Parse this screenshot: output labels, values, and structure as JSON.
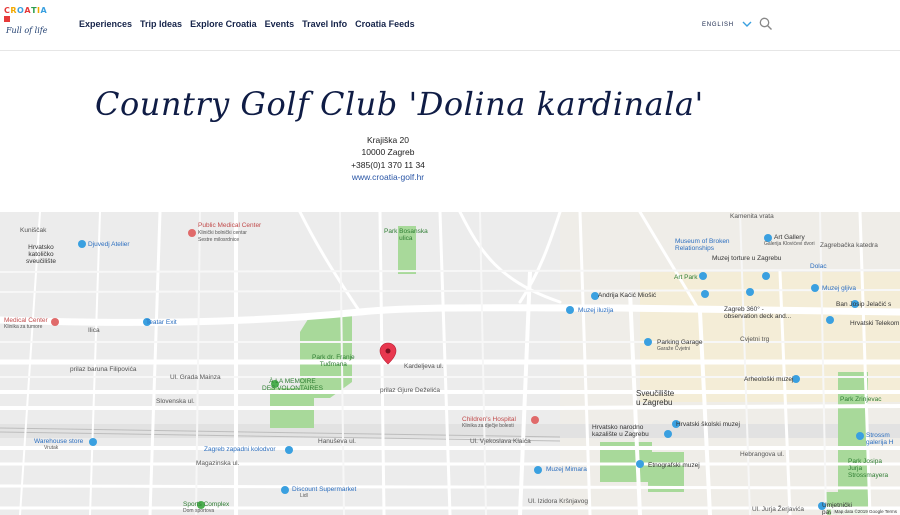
{
  "header": {
    "logo": {
      "word": "CROATIA",
      "tagline": "Full of life"
    },
    "nav": [
      "Experiences",
      "Trip Ideas",
      "Explore Croatia",
      "Events",
      "Travel Info",
      "Croatia Feeds"
    ],
    "language": "ENGLISH",
    "search_icon": "search-icon",
    "chevron_icon": "chevron-down-icon"
  },
  "page": {
    "title": "Country Golf Club 'Dolina kardinala'",
    "address_line1": "Krajiška 20",
    "address_line2": "10000 Zagreb",
    "phone": "+385(0)1 370 11 34",
    "website": "www.croatia-golf.hr"
  },
  "map": {
    "labels": {
      "kunicgaje": "Kuniščak",
      "skoliste": "Hrvatsko\nkatoličko\nsveučilište",
      "atelier": "Djuvedj Atelier",
      "medical": "Public Medical Center",
      "medical_sub": "Klinički bolnički centar\nSestre milosrdnice",
      "bosanska": "Park Bosanska\nulica",
      "kamenita": "Kamenita vrata",
      "art_gallery": "Art Gallery",
      "art_gallery_sub": "Galerija Klovićevi dvori",
      "broken": "Museum of Broken\nRelationships",
      "zagrebacka": "Zagrebačka katedra",
      "torture": "Muzej torture u Zagrebu",
      "dolac": "Dolac",
      "art_park": "Art Park",
      "kacic": "Andrija Kačić Miošić",
      "iluzija": "Muzej iluzija",
      "zagreb360": "Zagreb 360° -\nobservation deck and...",
      "jelacic": "Ban Josip Jelačić s",
      "muzej_gljiva": "Muzej gljiva",
      "telekom": "Hrvatski Telekom",
      "medical_center": "Medical Center",
      "medical_center_sub": "Klinika za tumore",
      "teatar": "Teatar Exit",
      "ilica": "Ilica",
      "tudman": "Park dr. Franje\nTuđmana",
      "parking": "Parking Garage",
      "parking_sub": "Garaže Cvjetni",
      "cvjetni": "Cvjetni trg",
      "filipovica": "prilaz baruna Filipovića",
      "mainza": "Ul. Grada Mainza",
      "memoire": "À LA MEMOIRE\nDES VOLONTAIRES",
      "dezelica": "prilaz Gjure Deželića",
      "kardeljeva": "Kardeljeva ul.",
      "slovenska": "Slovenska ul.",
      "sveuciliste": "Sveučilište\nu Zagrebu",
      "arheoloski": "Arheološki muzej",
      "zrinjevac": "Park Zrinjevac",
      "hospital": "Children's Hospital",
      "hospital_sub": "Klinika za dječje bolesti",
      "kazaliste": "Hrvatsko narodno\nkazalište u Zagrebu",
      "skolski": "Hrvatski školski muzej",
      "strossmayer": "Strossm\ngalerija H",
      "warehouse": "Warehouse store",
      "warehouse_sub": "Vrutak",
      "zapadni": "Zagreb zapadni kolodvor",
      "klaica": "Ul. Vjekoslava Klaića",
      "hanuseva": "Hanuševa ul.",
      "hebrangova": "Hebrangova ul.",
      "mimara": "Muzej Mimara",
      "etno": "Etnografski muzej",
      "jstross": "Park Josipa\nJurja\nStrossmayera",
      "magazinska": "Magazinska ul.",
      "sports": "Sports Complex",
      "sports_sub": "Dom sportova",
      "discount": "Discount Supermarket",
      "discount_sub": "Lidl",
      "umjetnicki": "Umjetnički\npaviljon",
      "krsnjavoga": "Ul. Izidora Kršnjavog",
      "zerjavica": "Ul. Jurja Žerjavića"
    },
    "footer": "Map data ©2019 Google   Terms"
  },
  "colors": {
    "navy": "#0f1c45",
    "link": "#2a56a6",
    "pin": "#e8384f",
    "park": "#a8d99a"
  }
}
